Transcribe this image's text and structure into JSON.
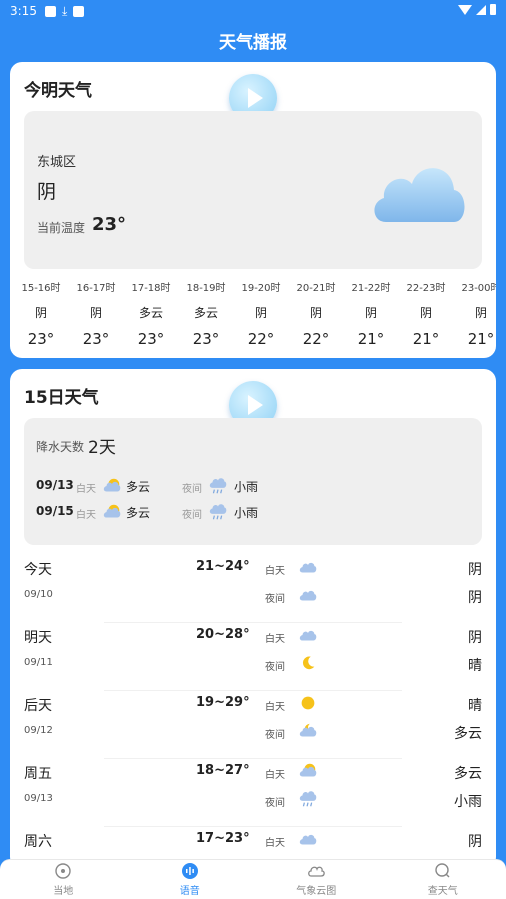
{
  "status_bar": {
    "time": "3:15"
  },
  "app_title": "天气播报",
  "today_card": {
    "title": "今明天气",
    "district": "东城区",
    "condition": "阴",
    "current_temp_label": "当前温度",
    "current_temp": "23°",
    "hourly": [
      {
        "time": "15-16时",
        "cond": "阴",
        "temp": "23°"
      },
      {
        "time": "16-17时",
        "cond": "阴",
        "temp": "23°"
      },
      {
        "time": "17-18时",
        "cond": "多云",
        "temp": "23°"
      },
      {
        "time": "18-19时",
        "cond": "多云",
        "temp": "23°"
      },
      {
        "time": "19-20时",
        "cond": "阴",
        "temp": "22°"
      },
      {
        "time": "20-21时",
        "cond": "阴",
        "temp": "22°"
      },
      {
        "time": "21-22时",
        "cond": "阴",
        "temp": "21°"
      },
      {
        "time": "22-23时",
        "cond": "阴",
        "temp": "21°"
      },
      {
        "time": "23-00时",
        "cond": "阴",
        "temp": "21°"
      }
    ]
  },
  "forecast_card": {
    "title": "15日天气",
    "rain_label": "降水天数",
    "rain_days": "2天",
    "rain_rows": [
      {
        "date": "09/13",
        "day_label": "白天",
        "day_cond": "多云",
        "night_label": "夜间",
        "night_cond": "小雨"
      },
      {
        "date": "09/15",
        "day_label": "白天",
        "day_cond": "多云",
        "night_label": "夜间",
        "night_cond": "小雨"
      }
    ],
    "days": [
      {
        "name": "今天",
        "date": "09/10",
        "range": "21~24°",
        "day_label": "白天",
        "night_label": "夜间",
        "day_cond": "阴",
        "night_cond": "阴",
        "day_icon": "cloud-icon",
        "night_icon": "cloud-icon"
      },
      {
        "name": "明天",
        "date": "09/11",
        "range": "20~28°",
        "day_label": "白天",
        "night_label": "夜间",
        "day_cond": "阴",
        "night_cond": "晴",
        "day_icon": "cloud-icon",
        "night_icon": "moon-icon"
      },
      {
        "name": "后天",
        "date": "09/12",
        "range": "19~29°",
        "day_label": "白天",
        "night_label": "夜间",
        "day_cond": "晴",
        "night_cond": "多云",
        "day_icon": "sun-icon",
        "night_icon": "moon-cloud-icon"
      },
      {
        "name": "周五",
        "date": "09/13",
        "range": "18~27°",
        "day_label": "白天",
        "night_label": "夜间",
        "day_cond": "多云",
        "night_cond": "小雨",
        "day_icon": "sun-cloud-icon",
        "night_icon": "rain-cloud-icon"
      },
      {
        "name": "周六",
        "date": "",
        "range": "17~23°",
        "day_label": "白天",
        "night_label": "",
        "day_cond": "阴",
        "night_cond": "",
        "day_icon": "cloud-icon",
        "night_icon": ""
      }
    ]
  },
  "tabs": [
    {
      "label": "当地",
      "icon": "location-icon"
    },
    {
      "label": "语音",
      "icon": "voice-icon"
    },
    {
      "label": "气象云图",
      "icon": "cloud-map-icon"
    },
    {
      "label": "查天气",
      "icon": "search-weather-icon"
    }
  ],
  "colors": {
    "primary": "#2f8cf4",
    "active_tab": "#2f8cf4"
  }
}
